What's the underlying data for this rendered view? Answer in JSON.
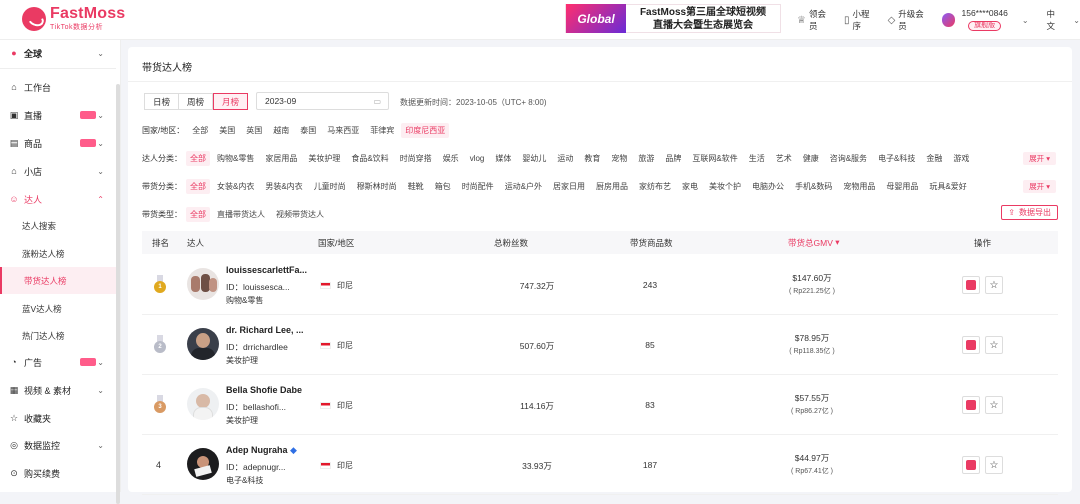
{
  "brand": {
    "name": "FastMoss",
    "subtitle": "TikTok数据分析"
  },
  "banner": {
    "image_text": "Global",
    "line1": "FastMoss第三届全球短视频",
    "line2": "直播大会暨生态展览会"
  },
  "topbar": {
    "vip": "领会员",
    "mini": "小程序",
    "upgrade": "升级会员",
    "phone": "156****0846",
    "badge": "旗舰版",
    "lang": "中文"
  },
  "sidebar": {
    "region": "全球",
    "items": [
      {
        "label": "工作台",
        "icon": "home-icon"
      },
      {
        "label": "直播",
        "icon": "live-icon"
      },
      {
        "label": "商品",
        "icon": "goods-icon"
      },
      {
        "label": "小店",
        "icon": "shop-icon"
      },
      {
        "label": "达人",
        "icon": "influencer-icon"
      },
      {
        "label": "广告",
        "icon": "ad-icon"
      },
      {
        "label": "视频 & 素材",
        "icon": "video-icon"
      },
      {
        "label": "收藏夹",
        "icon": "favorite-icon"
      },
      {
        "label": "数据监控",
        "icon": "monitor-icon"
      },
      {
        "label": "购买续费",
        "icon": "purchase-icon"
      }
    ],
    "sub_items": [
      "达人搜索",
      "涨粉达人榜",
      "带货达人榜",
      "蓝V达人榜",
      "热门达人榜"
    ]
  },
  "main": {
    "title": "带货达人榜",
    "tabs": [
      "日榜",
      "周榜",
      "月榜"
    ],
    "date": "2023-09",
    "update_label": "数据更新时间：",
    "update_time": "2023-10-05（UTC+ 8:00)",
    "region_label": "国家/地区：",
    "regions": [
      "全部",
      "美国",
      "英国",
      "越南",
      "泰国",
      "马来西亚",
      "菲律宾",
      "印度尼西亚"
    ],
    "influencer_label": "达人分类：",
    "influencer_categories": [
      "全部",
      "购物&零售",
      "家居用品",
      "美妆护理",
      "食品&饮料",
      "时尚穿搭",
      "娱乐",
      "vlog",
      "媒体",
      "婴幼儿",
      "运动",
      "教育",
      "宠物",
      "旅游",
      "品牌",
      "互联网&软件",
      "生活",
      "艺术",
      "健康",
      "咨询&服务",
      "电子&科技",
      "金融",
      "游戏"
    ],
    "goods_label": "带货分类：",
    "goods_categories": [
      "全部",
      "女装&内衣",
      "男装&内衣",
      "儿童时尚",
      "穆斯林时尚",
      "鞋靴",
      "箱包",
      "时尚配件",
      "运动&户外",
      "居家日用",
      "厨房用品",
      "家纺布艺",
      "家电",
      "美妆个护",
      "电脑办公",
      "手机&数码",
      "宠物用品",
      "母婴用品",
      "玩具&爱好"
    ],
    "type_label": "带货类型：",
    "types": [
      "全部",
      "直播带货达人",
      "视频带货达人"
    ],
    "expand": "展开",
    "export": "数据导出",
    "columns": [
      "排名",
      "达人",
      "国家/地区",
      "总粉丝数",
      "带货商品数",
      "带货总GMV",
      "操作"
    ]
  },
  "rows": [
    {
      "rank": "1",
      "name": "louissescarlettFa...",
      "id": "ID：louissesca...",
      "category": "购物&零售",
      "region": "印尼",
      "fans": "747.32万",
      "goods": "243",
      "gmv": "$147.60万",
      "gmv_local": "( Rp221.25亿 )"
    },
    {
      "rank": "2",
      "name": "dr. Richard Lee, ...",
      "id": "ID：drrichardlee",
      "category": "美妆护理",
      "region": "印尼",
      "fans": "507.60万",
      "goods": "85",
      "gmv": "$78.95万",
      "gmv_local": "( Rp118.35亿 )"
    },
    {
      "rank": "3",
      "name": "Bella Shofie Dabe",
      "id": "ID：bellashofi...",
      "category": "美妆护理",
      "region": "印尼",
      "fans": "114.16万",
      "goods": "83",
      "gmv": "$57.55万",
      "gmv_local": "( Rp86.27亿 )"
    },
    {
      "rank": "4",
      "name": "Adep Nugraha",
      "id": "ID：adepnugr...",
      "category": "电子&科技",
      "region": "印尼",
      "fans": "33.93万",
      "goods": "187",
      "gmv": "$44.97万",
      "gmv_local": "( Rp67.41亿 )"
    }
  ],
  "colors": {
    "accent": "#ea3a63",
    "gold": "#e0a91f",
    "silver": "#b9bcc8",
    "bronze": "#d99a63"
  }
}
